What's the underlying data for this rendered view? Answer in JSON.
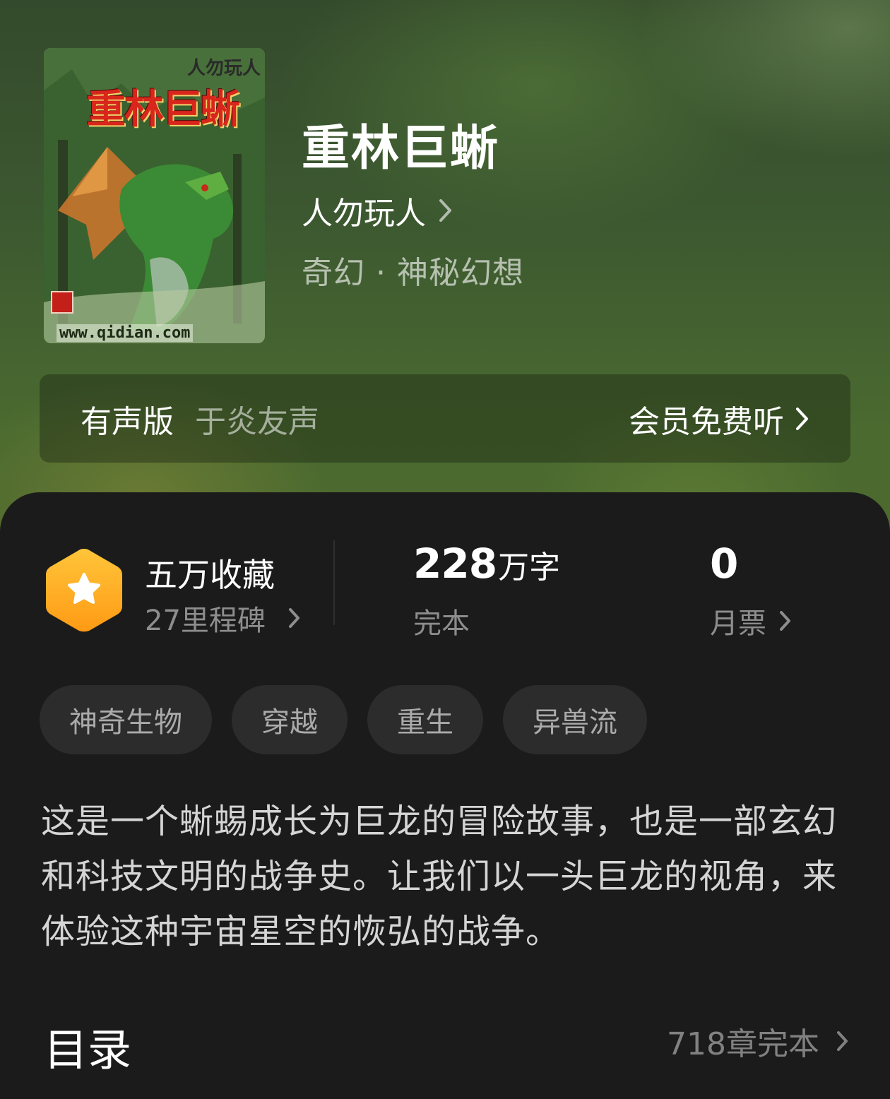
{
  "book": {
    "cover": {
      "author_text": "人勿玩人",
      "title_text": "重林巨蜥",
      "url_text": "www.qidian.com"
    },
    "title": "重林巨蜥",
    "author": "人勿玩人",
    "genre": "奇幻 · 神秘幻想"
  },
  "audio": {
    "label": "有声版",
    "narrator": "于炎友声",
    "action": "会员免费听"
  },
  "stats": {
    "favorites": "五万收藏",
    "milestones": "27里程碑",
    "word_count_value": "228",
    "word_count_unit": "万字",
    "status": "完本",
    "monthly_votes_value": "0",
    "monthly_votes_label": "月票"
  },
  "tags": [
    "神奇生物",
    "穿越",
    "重生",
    "异兽流"
  ],
  "description": "这是一个蜥蜴成长为巨龙的冒险故事，也是一部玄幻和科技文明的战争史。让我们以一头巨龙的视角，来体验这种宇宙星空的恢弘的战争。",
  "toc": {
    "title": "目录",
    "info": "718章完本"
  },
  "colors": {
    "badge_top": "#ffc53a",
    "badge_bottom": "#ff9a14",
    "panel_bg": "#1b1b1b",
    "tag_bg": "#2c2c2c"
  },
  "icons": [
    "chevron-right-icon",
    "star-icon",
    "hexagon-badge-icon"
  ]
}
